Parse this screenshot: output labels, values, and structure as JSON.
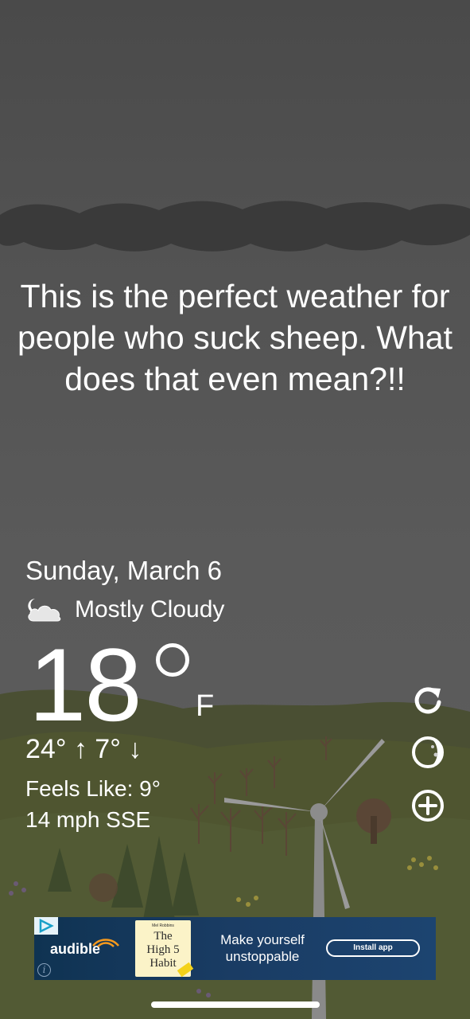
{
  "quote": "This is the perfect weather for people who suck sheep. What does that even mean?!!",
  "date": "Sunday, March 6",
  "condition": {
    "icon": "cloud-moon-icon",
    "text": "Mostly Cloudy"
  },
  "temperature": {
    "value": "18",
    "unit": "F"
  },
  "hi_lo": "24° ↑  7° ↓",
  "feels_like": "Feels Like: 9°",
  "wind": "14 mph SSE",
  "side_actions": [
    {
      "name": "refresh",
      "icon": "refresh-icon"
    },
    {
      "name": "moon-phase",
      "icon": "moon-phase-icon"
    },
    {
      "name": "add",
      "icon": "plus-circle-icon"
    }
  ],
  "ad": {
    "brand": "audible",
    "book": {
      "author": "Mel Robbins",
      "title_line1": "The",
      "title_line2": "High 5",
      "title_line3": "Habit"
    },
    "headline": "Make yourself unstoppable",
    "cta": "Install app",
    "info_glyph": "i"
  },
  "colors": {
    "sky": "#545454",
    "storm_cloud": "#3a3a3a",
    "hills": "#4f5530",
    "text": "#ffffff",
    "ad_background": "#1a3c64"
  }
}
